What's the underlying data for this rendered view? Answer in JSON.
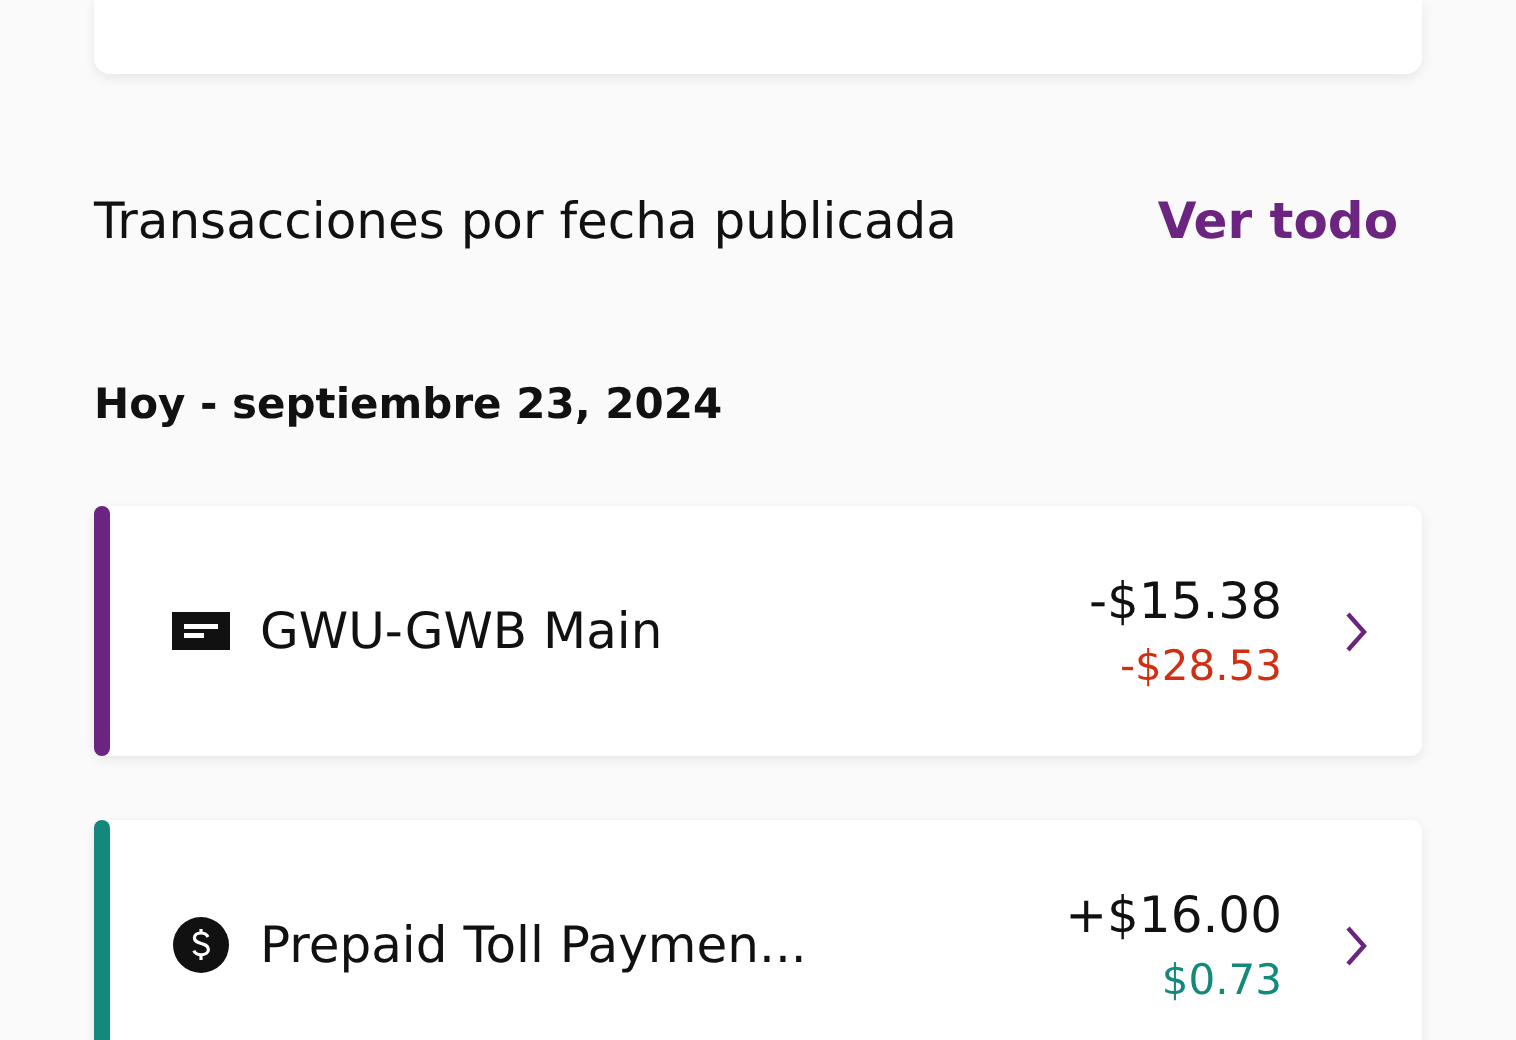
{
  "section": {
    "title": "Transacciones por fecha publicada",
    "link": "Ver todo"
  },
  "date_heading": "Hoy - septiembre 23, 2024",
  "transactions": [
    {
      "kind": "toll",
      "name": "GWU-GWB Main",
      "amount": "-$15.38",
      "balance": "-$28.53",
      "negative_balance": true,
      "color": "#6b2480"
    },
    {
      "kind": "payment",
      "name": "Prepaid Toll Paymen...",
      "amount": "+$16.00",
      "balance": "$0.73",
      "negative_balance": false,
      "color": "#12897a"
    }
  ]
}
